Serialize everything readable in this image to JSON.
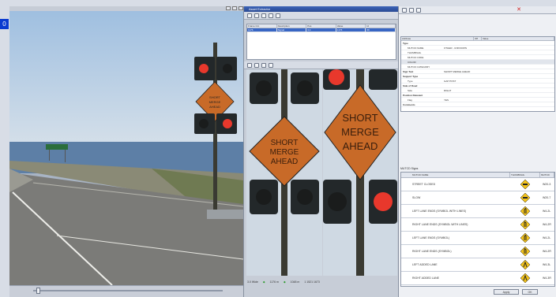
{
  "left_viewer": {
    "frame_number": "0"
  },
  "annotator": {
    "title": "Asset Extractor",
    "assets_table": {
      "columns": [
        "Frame Cnt",
        "Description",
        "Pos",
        "Value",
        "Id"
      ],
      "rows": [
        [
          "1176",
          "Signal",
          "3.4",
          "1176",
          "69"
        ]
      ]
    },
    "zoom_left_label": "3.0 Wide",
    "zoom_left_value": "1176 m",
    "zoom_right_label": "1048 m",
    "zoom_right_value": "1 1521 1673"
  },
  "properties": {
    "columns": [
      "Attribute",
      "Off",
      "Value"
    ],
    "rows": [
      {
        "key": "Type",
        "value": "",
        "cat": true
      },
      {
        "key": "MUTCD NAME",
        "value": "OTHER - UNKNOWN"
      },
      {
        "key": "THUMBNAIL",
        "value": ""
      },
      {
        "key": "MUTCD CODE",
        "value": ""
      },
      {
        "key": "COLOR",
        "value": ""
      },
      {
        "key": "MUTCD CATEGORY",
        "value": ""
      },
      {
        "key": "Sign Text",
        "value": "SHORT MERGE AHEAD",
        "cat": true
      },
      {
        "key": "Support Type",
        "value": "",
        "cat": true
      },
      {
        "key": "Type",
        "value": "GAP POST"
      },
      {
        "key": "Side of Road",
        "value": "",
        "cat": true
      },
      {
        "key": "Side",
        "value": "RIGHT"
      },
      {
        "key": "Position Relevant",
        "value": "",
        "cat": true
      },
      {
        "key": "Flag",
        "value": "YES"
      },
      {
        "key": "Comments",
        "value": "",
        "cat": true
      }
    ]
  },
  "library": {
    "header_title": "MUTCD Signs",
    "columns": [
      "MUTCD NAME",
      "THUMBNAIL",
      "MUTCD"
    ],
    "rows": [
      {
        "name": "STREET CLOSED",
        "code": "W20-3"
      },
      {
        "name": "SLOW",
        "code": "W20-7"
      },
      {
        "name": "LEFT LANE ENDS (SYMBOL WITH LINES)",
        "code": "W4-2L"
      },
      {
        "name": "RIGHT LANE ENDS (SYMBOL WITH LINES)",
        "code": "W4-2R"
      },
      {
        "name": "LEFT LANE ENDS (SYMBOL)",
        "code": "W4-2L"
      },
      {
        "name": "RIGHT LANE ENDS (SYMBOL)",
        "code": "W4-2R"
      },
      {
        "name": "LEFT ADDED LANE",
        "code": "W4-3L"
      },
      {
        "name": "RIGHT ADDED LANE",
        "code": "W4-3R"
      }
    ],
    "buttons": [
      "Apply",
      "OK"
    ]
  },
  "sign_text": "SHORT MERGE AHEAD",
  "colors": {
    "signal_red": "#e8382c",
    "sign_orange": "#c86a28",
    "sky": "#b6cfe6",
    "water": "#5d7fa6",
    "titlebar": "#2a4a94",
    "selection": "#3866c4"
  }
}
